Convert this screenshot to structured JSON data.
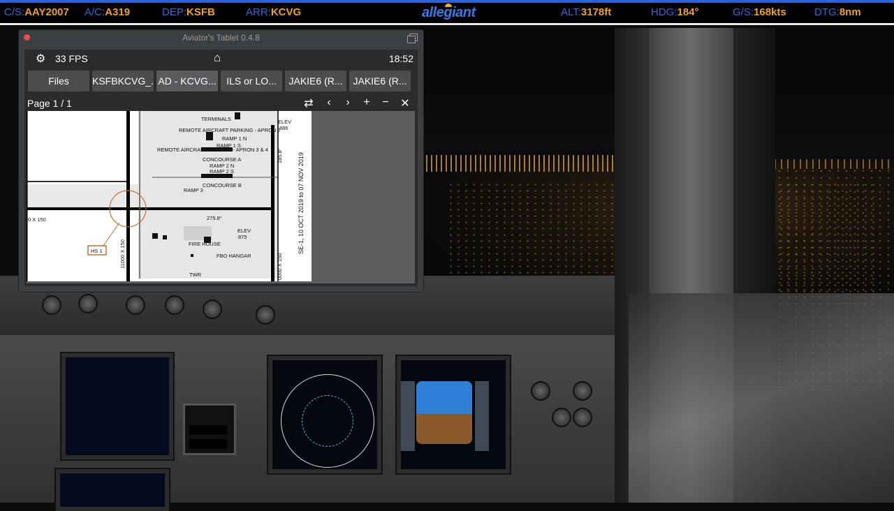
{
  "status_bar": {
    "callsign_key": "C/S:",
    "callsign": "AAY2007",
    "aircraft_key": "A/C:",
    "aircraft": "A319",
    "departure_key": "DEP:",
    "departure": "KSFB",
    "arrival_key": "ARR:",
    "arrival": "KCVG",
    "brand": "allegiant",
    "altitude_key": "ALT:",
    "altitude": "3178ft",
    "heading_key": "HDG:",
    "heading": "184°",
    "groundspeed_key": "G/S:",
    "groundspeed": "168kts",
    "distance_key": "DTG:",
    "distance": "8nm"
  },
  "tablet": {
    "title": "Aviator's Tablet  0.4.8",
    "fps": "33 FPS",
    "time": "18:52",
    "tabs": [
      "Files",
      "KSFBKCVG_...",
      "AD - KCVG...",
      "ILS or LO...",
      "JAKIE6 (R...",
      "JAKIE6 (R..."
    ],
    "active_tab": 2,
    "page": "Page 1 / 1",
    "icons": [
      "gear-icon",
      "home-icon",
      "rotate-icon",
      "prev-page-icon",
      "next-page-icon",
      "zoom-in-icon",
      "zoom-out-icon",
      "close-icon"
    ]
  },
  "chart": {
    "labels": {
      "terminals": "TERMINALS",
      "remote_parking_2": "REMOTE AIRCRAFT PARKING - APRON 2",
      "remote_parking_34": "REMOTE AIRCRAFT PARKING - APRON 3 & 4",
      "ramp1n": "RAMP 1 N",
      "ramp1s": "RAMP 1 S",
      "concourse_a": "CONCOURSE A",
      "ramp2n": "RAMP 2 N",
      "ramp2s": "RAMP 2 S",
      "concourse_b": "CONCOURSE B",
      "ramp3": "RAMP 3",
      "elev_top": "ELEV",
      "elev_top_val": "886",
      "elev_mid": "ELEV",
      "elev_mid_val": "875",
      "fire_house": "FIRE HOUSE",
      "fbo_hangar": "FBO HANGAR",
      "twr": "TWR",
      "hs1": "HS 1",
      "rwy_dims_left": "0 X 150",
      "rwy_dims_vert": "11000 X 150",
      "rwy_dims_right": "0000 X 150",
      "hdg_275": "275.8°",
      "hdg_185": "185.8°",
      "validity": "SE-1, 10 OCT 2019 to 07 NOV 2019"
    }
  }
}
